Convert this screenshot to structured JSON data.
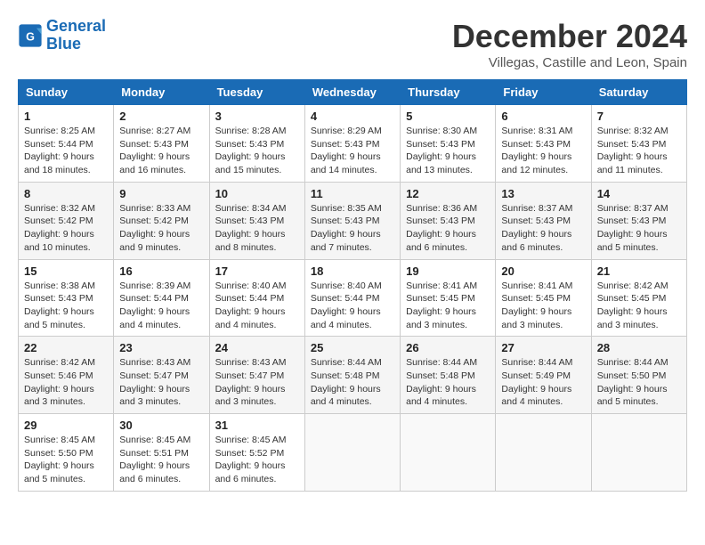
{
  "header": {
    "logo_line1": "General",
    "logo_line2": "Blue",
    "month_title": "December 2024",
    "location": "Villegas, Castille and Leon, Spain"
  },
  "calendar": {
    "days_of_week": [
      "Sunday",
      "Monday",
      "Tuesday",
      "Wednesday",
      "Thursday",
      "Friday",
      "Saturday"
    ],
    "weeks": [
      [
        {
          "day": "1",
          "sunrise": "8:25 AM",
          "sunset": "5:44 PM",
          "daylight": "9 hours and 18 minutes."
        },
        {
          "day": "2",
          "sunrise": "8:27 AM",
          "sunset": "5:43 PM",
          "daylight": "9 hours and 16 minutes."
        },
        {
          "day": "3",
          "sunrise": "8:28 AM",
          "sunset": "5:43 PM",
          "daylight": "9 hours and 15 minutes."
        },
        {
          "day": "4",
          "sunrise": "8:29 AM",
          "sunset": "5:43 PM",
          "daylight": "9 hours and 14 minutes."
        },
        {
          "day": "5",
          "sunrise": "8:30 AM",
          "sunset": "5:43 PM",
          "daylight": "9 hours and 13 minutes."
        },
        {
          "day": "6",
          "sunrise": "8:31 AM",
          "sunset": "5:43 PM",
          "daylight": "9 hours and 12 minutes."
        },
        {
          "day": "7",
          "sunrise": "8:32 AM",
          "sunset": "5:43 PM",
          "daylight": "9 hours and 11 minutes."
        }
      ],
      [
        {
          "day": "8",
          "sunrise": "8:32 AM",
          "sunset": "5:42 PM",
          "daylight": "9 hours and 10 minutes."
        },
        {
          "day": "9",
          "sunrise": "8:33 AM",
          "sunset": "5:42 PM",
          "daylight": "9 hours and 9 minutes."
        },
        {
          "day": "10",
          "sunrise": "8:34 AM",
          "sunset": "5:43 PM",
          "daylight": "9 hours and 8 minutes."
        },
        {
          "day": "11",
          "sunrise": "8:35 AM",
          "sunset": "5:43 PM",
          "daylight": "9 hours and 7 minutes."
        },
        {
          "day": "12",
          "sunrise": "8:36 AM",
          "sunset": "5:43 PM",
          "daylight": "9 hours and 6 minutes."
        },
        {
          "day": "13",
          "sunrise": "8:37 AM",
          "sunset": "5:43 PM",
          "daylight": "9 hours and 6 minutes."
        },
        {
          "day": "14",
          "sunrise": "8:37 AM",
          "sunset": "5:43 PM",
          "daylight": "9 hours and 5 minutes."
        }
      ],
      [
        {
          "day": "15",
          "sunrise": "8:38 AM",
          "sunset": "5:43 PM",
          "daylight": "9 hours and 5 minutes."
        },
        {
          "day": "16",
          "sunrise": "8:39 AM",
          "sunset": "5:44 PM",
          "daylight": "9 hours and 4 minutes."
        },
        {
          "day": "17",
          "sunrise": "8:40 AM",
          "sunset": "5:44 PM",
          "daylight": "9 hours and 4 minutes."
        },
        {
          "day": "18",
          "sunrise": "8:40 AM",
          "sunset": "5:44 PM",
          "daylight": "9 hours and 4 minutes."
        },
        {
          "day": "19",
          "sunrise": "8:41 AM",
          "sunset": "5:45 PM",
          "daylight": "9 hours and 3 minutes."
        },
        {
          "day": "20",
          "sunrise": "8:41 AM",
          "sunset": "5:45 PM",
          "daylight": "9 hours and 3 minutes."
        },
        {
          "day": "21",
          "sunrise": "8:42 AM",
          "sunset": "5:45 PM",
          "daylight": "9 hours and 3 minutes."
        }
      ],
      [
        {
          "day": "22",
          "sunrise": "8:42 AM",
          "sunset": "5:46 PM",
          "daylight": "9 hours and 3 minutes."
        },
        {
          "day": "23",
          "sunrise": "8:43 AM",
          "sunset": "5:47 PM",
          "daylight": "9 hours and 3 minutes."
        },
        {
          "day": "24",
          "sunrise": "8:43 AM",
          "sunset": "5:47 PM",
          "daylight": "9 hours and 3 minutes."
        },
        {
          "day": "25",
          "sunrise": "8:44 AM",
          "sunset": "5:48 PM",
          "daylight": "9 hours and 4 minutes."
        },
        {
          "day": "26",
          "sunrise": "8:44 AM",
          "sunset": "5:48 PM",
          "daylight": "9 hours and 4 minutes."
        },
        {
          "day": "27",
          "sunrise": "8:44 AM",
          "sunset": "5:49 PM",
          "daylight": "9 hours and 4 minutes."
        },
        {
          "day": "28",
          "sunrise": "8:44 AM",
          "sunset": "5:50 PM",
          "daylight": "9 hours and 5 minutes."
        }
      ],
      [
        {
          "day": "29",
          "sunrise": "8:45 AM",
          "sunset": "5:50 PM",
          "daylight": "9 hours and 5 minutes."
        },
        {
          "day": "30",
          "sunrise": "8:45 AM",
          "sunset": "5:51 PM",
          "daylight": "9 hours and 6 minutes."
        },
        {
          "day": "31",
          "sunrise": "8:45 AM",
          "sunset": "5:52 PM",
          "daylight": "9 hours and 6 minutes."
        },
        null,
        null,
        null,
        null
      ]
    ]
  }
}
